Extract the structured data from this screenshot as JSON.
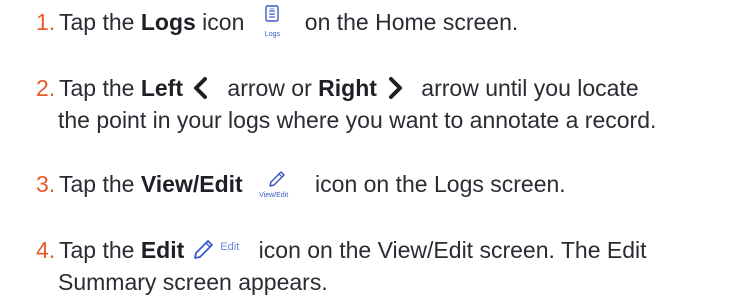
{
  "steps": [
    {
      "number": "1.",
      "before": "Tap the ",
      "bold1": "Logs",
      "mid1": " icon",
      "icon_label": "Logs",
      "after": " on the Home screen."
    },
    {
      "number": "2.",
      "before": "Tap the ",
      "bold1": "Left",
      "mid1": " arrow or ",
      "bold2": "Right",
      "after": " arrow until you locate",
      "line2": "the point in your logs where you want to annotate a record."
    },
    {
      "number": "3.",
      "before": "Tap the ",
      "bold1": "View/Edit",
      "icon_label": "View/Edit",
      "after": " icon on the Logs screen."
    },
    {
      "number": "4.",
      "before": "Tap the ",
      "bold1": "Edit",
      "icon_label": "Edit",
      "after": " icon on the View/Edit screen. The Edit",
      "line2": "Summary screen appears."
    }
  ],
  "colors": {
    "step_number": "#e85a2a",
    "icon": "#3a5bc8",
    "text": "#2b2b33"
  },
  "icons": [
    "logs-icon",
    "chevron-left-icon",
    "chevron-right-icon",
    "pencil-icon"
  ]
}
